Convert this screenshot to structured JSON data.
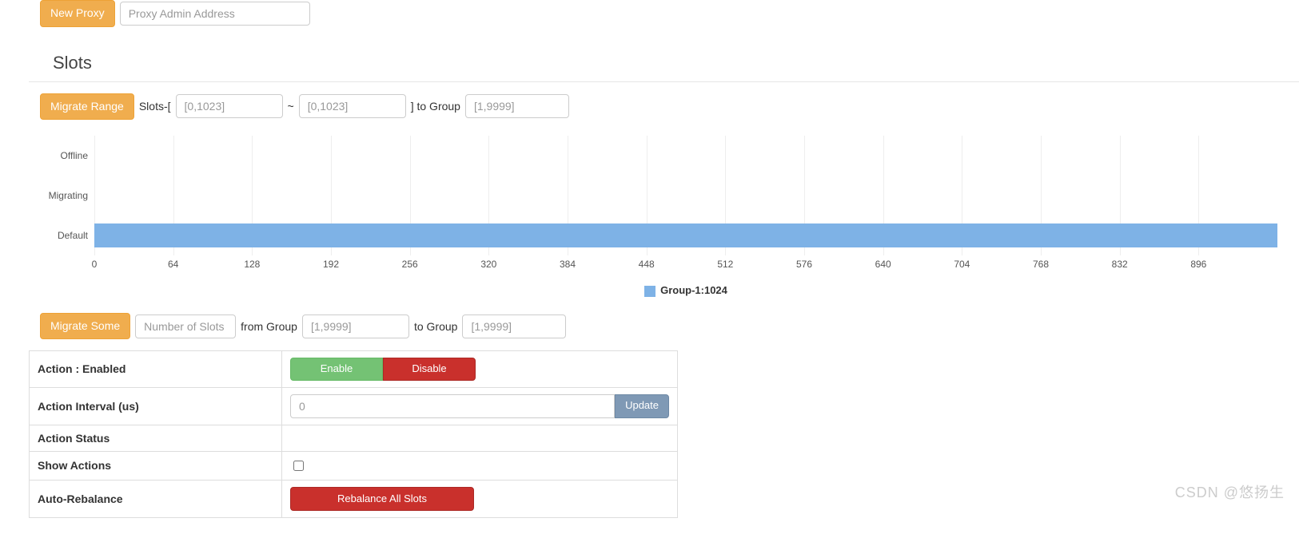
{
  "proxy": {
    "new_label": "New Proxy",
    "addr_placeholder": "Proxy Admin Address"
  },
  "slots": {
    "title": "Slots",
    "migrate_range_label": "Migrate Range",
    "range_prefix": "Slots-[",
    "range_sep": "~",
    "range_suffix": "] to Group",
    "range_placeholder": "[0,1023]",
    "group_placeholder": "[1,9999]",
    "migrate_some_label": "Migrate Some",
    "num_slots_placeholder": "Number of Slots",
    "from_group_label": "from Group",
    "to_group_label": "to Group"
  },
  "chart_data": {
    "type": "bar",
    "orientation": "horizontal",
    "categories": [
      "Offline",
      "Migrating",
      "Default"
    ],
    "values": [
      0,
      0,
      1024
    ],
    "xlim": [
      0,
      960
    ],
    "x_ticks": [
      0,
      64,
      128,
      192,
      256,
      320,
      384,
      448,
      512,
      576,
      640,
      704,
      768,
      832,
      896
    ],
    "legend": "Group-1:1024",
    "color": "#7eb2e6"
  },
  "action": {
    "status_label": "Action : Enabled",
    "enable_label": "Enable",
    "disable_label": "Disable",
    "interval_label": "Action Interval (us)",
    "interval_placeholder": "0",
    "update_label": "Update",
    "actionstatus_label": "Action Status",
    "show_label": "Show Actions",
    "auto_label": "Auto-Rebalance",
    "rebalance_label": "Rebalance All Slots"
  },
  "watermark": "CSDN @悠扬生"
}
